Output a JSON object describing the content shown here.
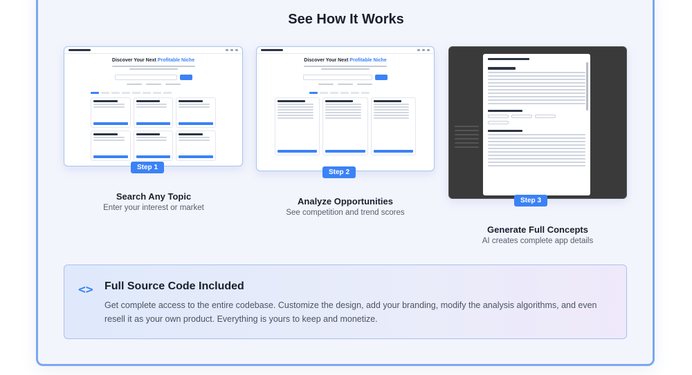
{
  "section": {
    "title": "See How It Works"
  },
  "mock_app": {
    "headline_prefix": "Discover Your Next ",
    "headline_accent": "Profitable Niche"
  },
  "steps": [
    {
      "badge": "Step 1",
      "title": "Search Any Topic",
      "description": "Enter your interest or market"
    },
    {
      "badge": "Step 2",
      "title": "Analyze Opportunities",
      "description": "See competition and trend scores"
    },
    {
      "badge": "Step 3",
      "title": "Generate Full Concepts",
      "description": "AI creates complete app details"
    }
  ],
  "source_code": {
    "icon": "code-brackets-icon",
    "title": "Full Source Code Included",
    "body": "Get complete access to the entire codebase. Customize the design, add your branding, modify the analysis algorithms, and even resell it as your own product. Everything is yours to keep and monetize."
  },
  "colors": {
    "accent": "#3b82f6",
    "card_border": "#7aa7ef",
    "card_bg": "#f3f5fd"
  }
}
